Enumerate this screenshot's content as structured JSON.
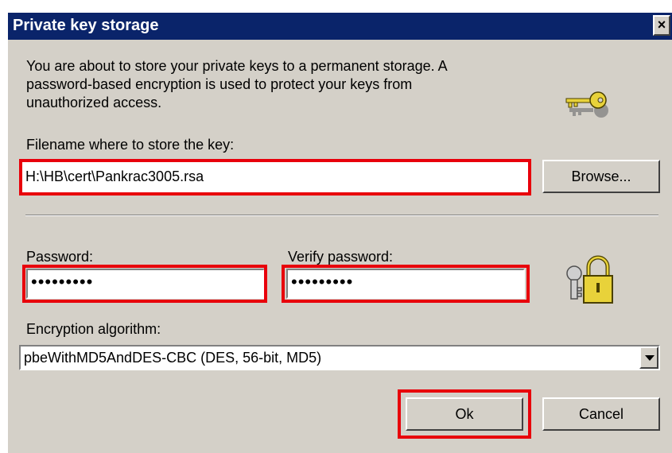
{
  "window": {
    "title": "Private key storage",
    "close_glyph": "×"
  },
  "intro": {
    "line1": "You are about to store your private keys to a permanent storage. A",
    "line2": "password-based encryption is used to protect your keys from",
    "line3": "unauthorized access."
  },
  "filename": {
    "label": "Filename where to store the key:",
    "value": "H:\\HB\\cert\\Pankrac3005.rsa",
    "browse_label": "Browse..."
  },
  "password": {
    "label": "Password:",
    "value": "•••••••••"
  },
  "verify": {
    "label": "Verify password:",
    "value": "•••••••••"
  },
  "encryption": {
    "label": "Encryption algorithm:",
    "selected": "pbeWithMD5AndDES-CBC (DES, 56-bit, MD5)"
  },
  "buttons": {
    "ok": "Ok",
    "cancel": "Cancel"
  },
  "icons": {
    "key": "key-icon",
    "lock": "padlock-keys-icon"
  },
  "colors": {
    "titlebar": "#0a246a",
    "face": "#d4d0c8",
    "highlight": "#e8000b"
  }
}
